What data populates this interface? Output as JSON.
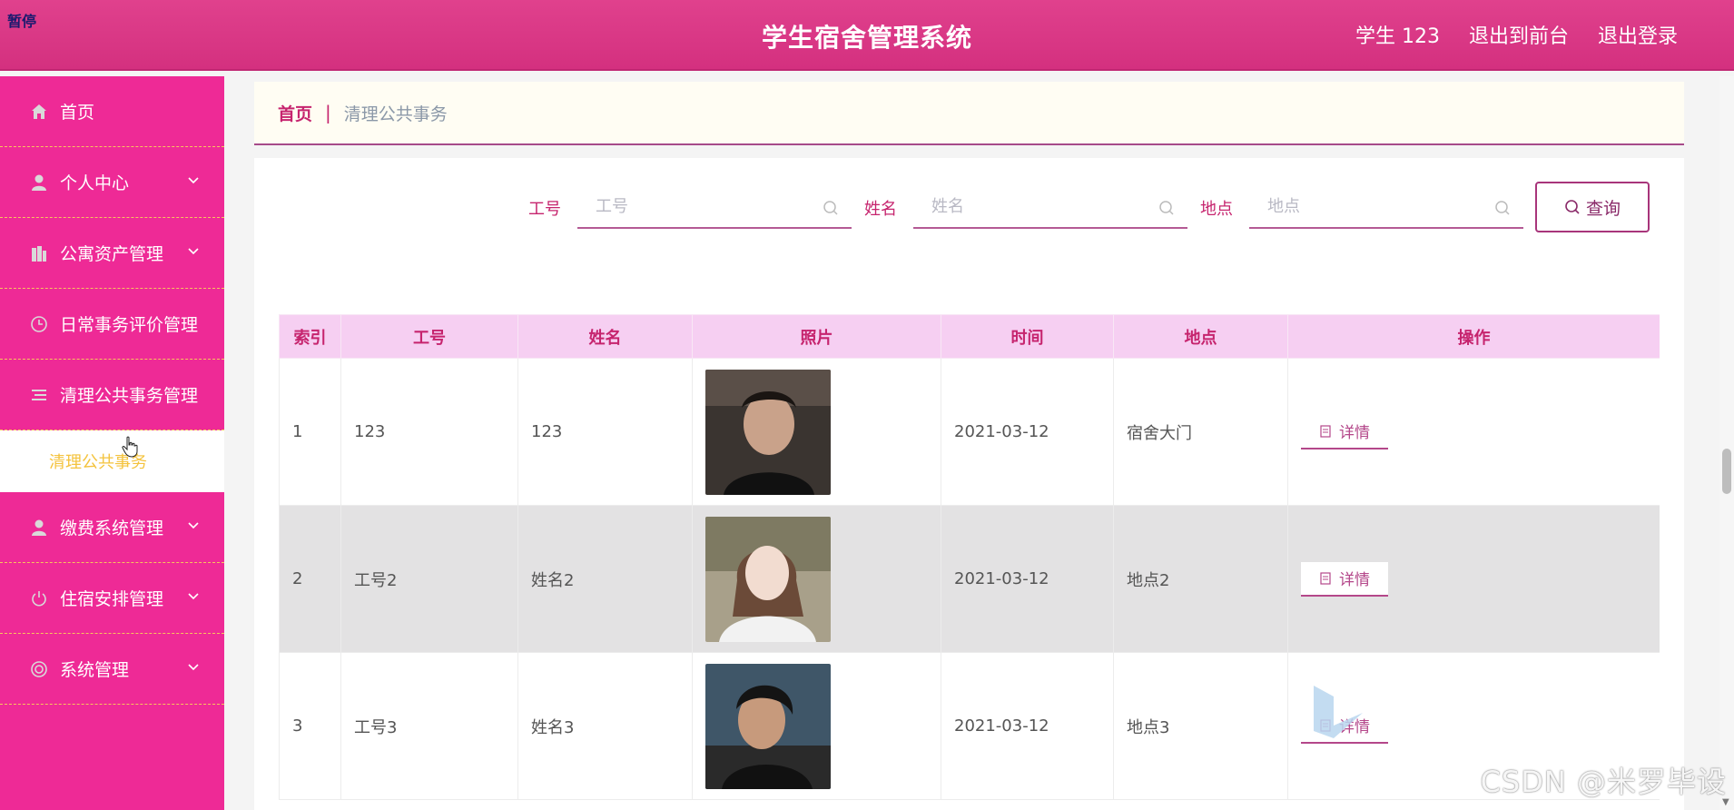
{
  "header": {
    "badge": "暂停",
    "title": "学生宿舍管理系统",
    "user": "学生 123",
    "back_to_front": "退出到前台",
    "logout": "退出登录"
  },
  "sidebar": {
    "items": [
      {
        "label": "首页",
        "icon": "home-icon",
        "expandable": false
      },
      {
        "label": "个人中心",
        "icon": "user-icon",
        "expandable": true
      },
      {
        "label": "公寓资产管理",
        "icon": "building-icon",
        "expandable": true
      },
      {
        "label": "日常事务评价管理",
        "icon": "clock-icon",
        "expandable": false
      },
      {
        "label": "清理公共事务管理",
        "icon": "list-icon",
        "expandable": false
      },
      {
        "label": "缴费系统管理",
        "icon": "user-icon",
        "expandable": true
      },
      {
        "label": "住宿安排管理",
        "icon": "power-icon",
        "expandable": true
      },
      {
        "label": "系统管理",
        "icon": "settings-icon",
        "expandable": true
      }
    ],
    "submenu_label": "清理公共事务"
  },
  "breadcrumb": {
    "home": "首页",
    "separator": "|",
    "current": "清理公共事务"
  },
  "search": {
    "fields": [
      {
        "label": "工号",
        "placeholder": "工号"
      },
      {
        "label": "姓名",
        "placeholder": "姓名"
      },
      {
        "label": "地点",
        "placeholder": "地点"
      }
    ],
    "button": "查询"
  },
  "table": {
    "columns": [
      "索引",
      "工号",
      "姓名",
      "照片",
      "时间",
      "地点",
      "操作"
    ],
    "rows": [
      {
        "index": "1",
        "job_no": "123",
        "name": "123",
        "photo": "photo-boy",
        "time": "2021-03-12",
        "location": "宿舍大门",
        "action": "详情"
      },
      {
        "index": "2",
        "job_no": "工号2",
        "name": "姓名2",
        "photo": "photo-girl",
        "time": "2021-03-12",
        "location": "地点2",
        "action": "详情"
      },
      {
        "index": "3",
        "job_no": "工号3",
        "name": "姓名3",
        "photo": "photo-man",
        "time": "2021-03-12",
        "location": "地点3",
        "action": "详情"
      }
    ]
  },
  "watermark": "CSDN @米罗毕设",
  "colors": {
    "primary": "#ee2a96",
    "header": "#d4307f",
    "accent": "#c6246e",
    "submenu_text": "#f4c33d"
  }
}
